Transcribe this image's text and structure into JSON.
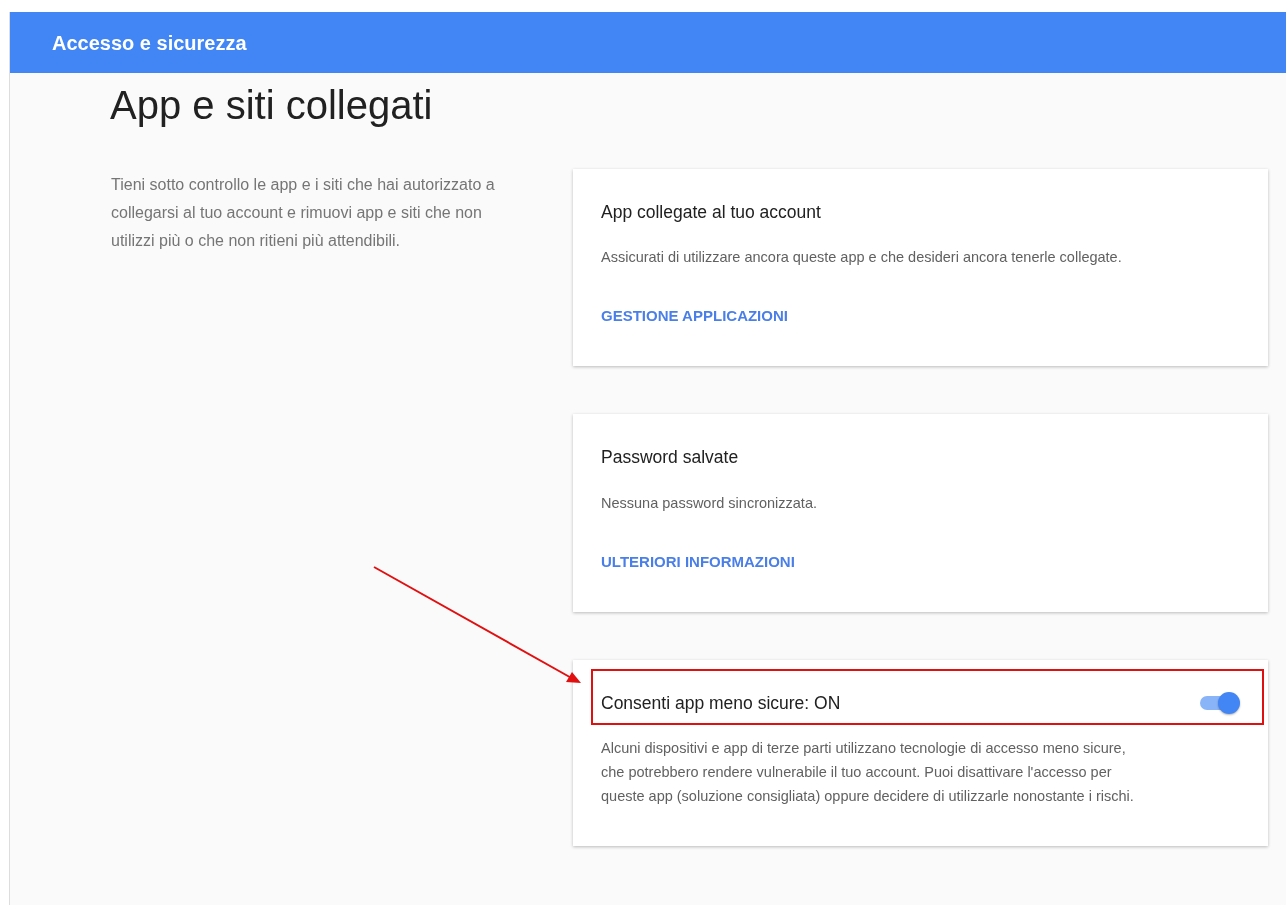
{
  "header": {
    "title": "Accesso e sicurezza"
  },
  "page": {
    "heading": "App e siti collegati",
    "description": "Tieni sotto controllo le app e i siti che hai autorizzato a collegarsi al tuo account e rimuovi app e siti che non utilizzi più o che non ritieni più attendibili."
  },
  "cards": [
    {
      "kind": "link",
      "title": "App collegate al tuo account",
      "text": "Assicurati di utilizzare ancora queste app e che desideri ancora tenerle collegate.",
      "link": "GESTIONE APPLICAZIONI"
    },
    {
      "kind": "link",
      "title": "Password salvate",
      "text": "Nessuna password sincronizzata.",
      "link": "ULTERIORI INFORMAZIONI"
    },
    {
      "kind": "toggle",
      "title": "Consenti app meno sicure: ON",
      "on": true,
      "highlighted": true,
      "text": "Alcuni dispositivi e app di terze parti utilizzano tecnologie di accesso meno sicure, che potrebbero rendere vulnerabile il tuo account. Puoi disattivare l'accesso per queste app (soluzione consigliata) oppure decidere di utilizzarle nonostante i rischi."
    }
  ]
}
